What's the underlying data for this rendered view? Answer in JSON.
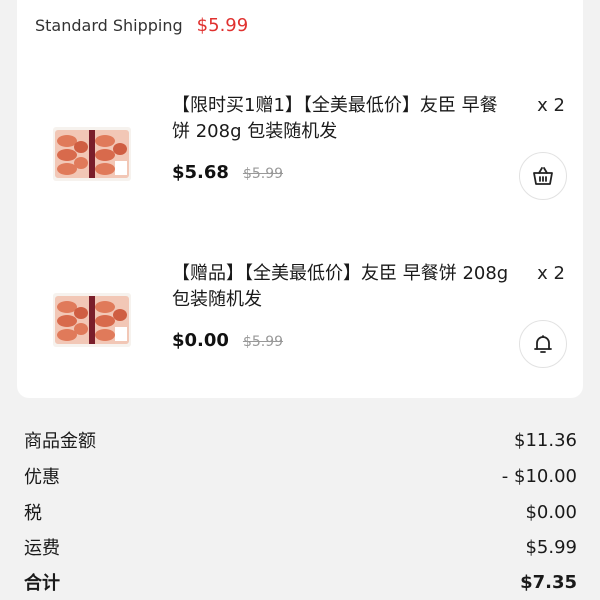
{
  "shipping": {
    "label": "Standard Shipping",
    "price": "$5.99"
  },
  "items": [
    {
      "title": "【限时买1赠1】【全美最低价】友臣 早餐饼 208g 包装随机发",
      "qty": "x 2",
      "price": "$5.68",
      "original_price": "$5.99",
      "action_icon": "basket-icon"
    },
    {
      "title": "【赠品】【全美最低价】友臣 早餐饼 208g 包装随机发",
      "qty": "x 2",
      "price": "$0.00",
      "original_price": "$5.99",
      "action_icon": "bell-icon"
    }
  ],
  "summary": {
    "subtotal_label": "商品金额",
    "subtotal_value": "$11.36",
    "discount_label": "优惠",
    "discount_value": "- $10.00",
    "tax_label": "税",
    "tax_value": "$0.00",
    "shipping_label": "运费",
    "shipping_value": "$5.99",
    "total_label": "合计",
    "total_value": "$7.35"
  },
  "colors": {
    "accent_red": "#e0312f",
    "muted": "#999999"
  }
}
